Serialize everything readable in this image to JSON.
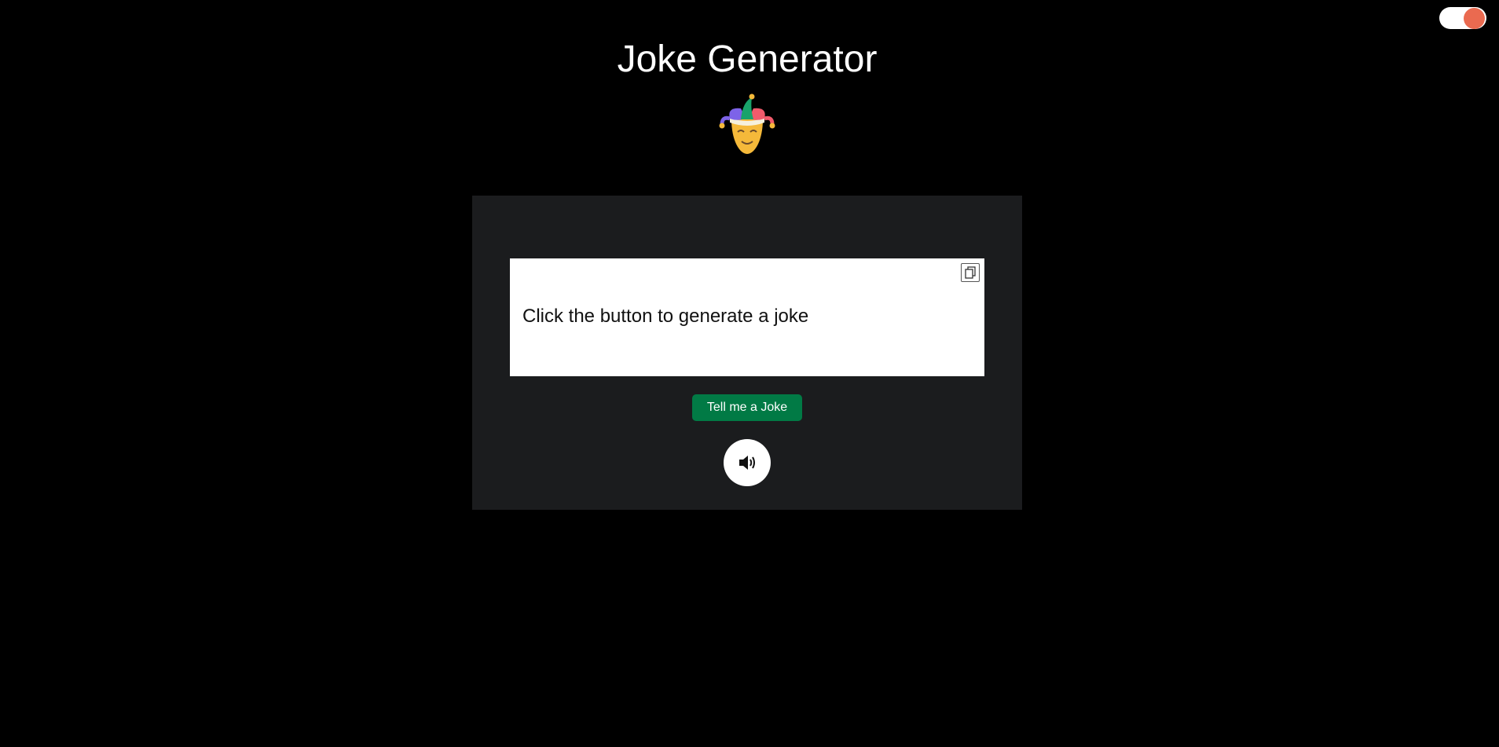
{
  "header": {
    "title": "Joke Generator",
    "mascot_icon": "jester-mask-icon"
  },
  "theme_toggle": {
    "state": "on",
    "track_color": "#ffffff",
    "knob_color": "#ea6a50"
  },
  "joke_card": {
    "joke_text": "Click the button to generate a joke",
    "copy_icon": "copy-icon",
    "generate_button_label": "Tell me a Joke",
    "speak_icon": "speaker-icon"
  },
  "colors": {
    "background": "#000000",
    "card": "#1b1c1e",
    "button": "#017a45"
  }
}
